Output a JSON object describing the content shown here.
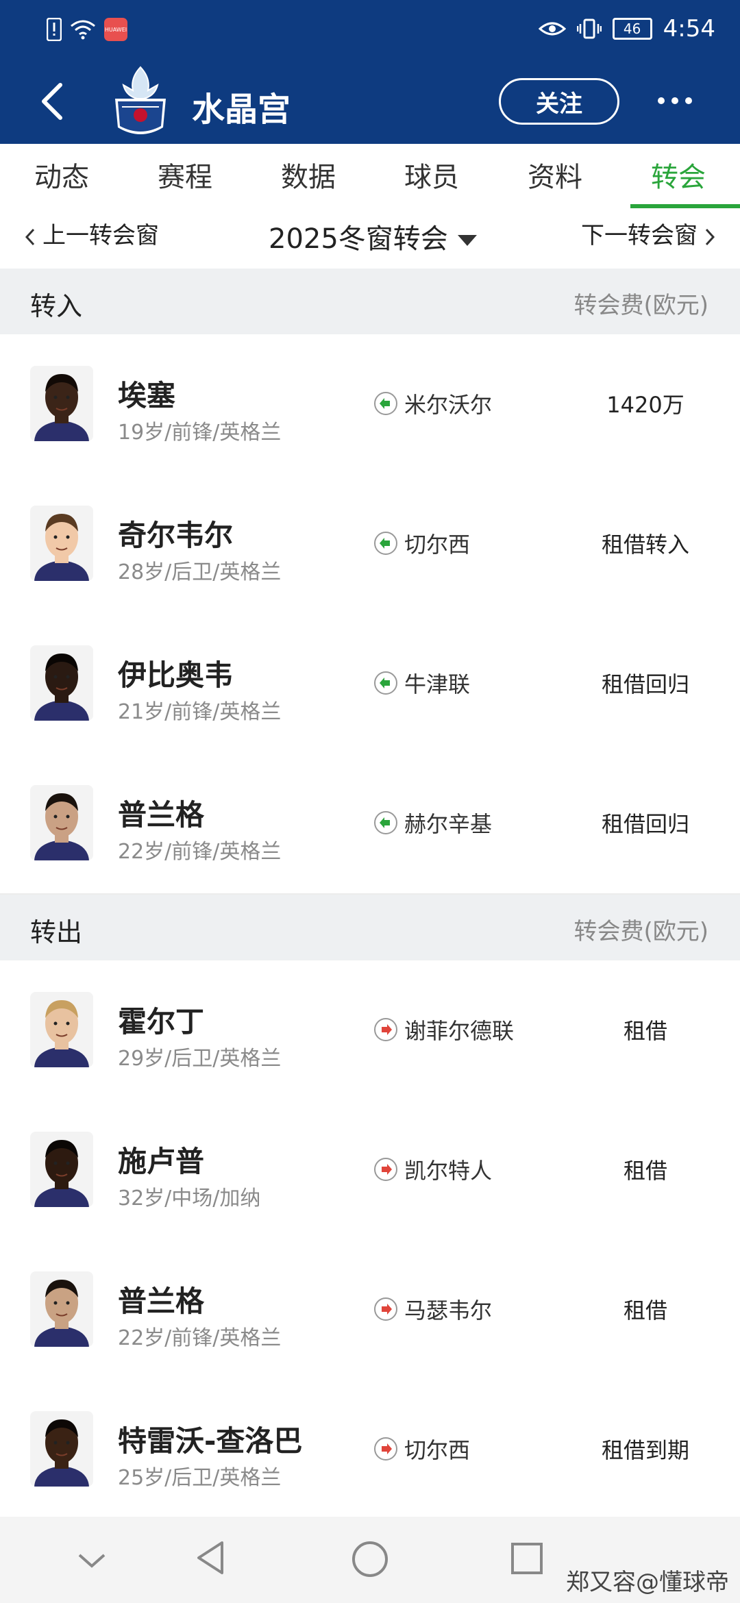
{
  "status_bar": {
    "time": "4:54",
    "battery": "46",
    "app_badge": "HUAWEI"
  },
  "nav": {
    "team": "水晶宫",
    "follow_label": "关注"
  },
  "tabs": [
    {
      "label": "动态",
      "active": false
    },
    {
      "label": "赛程",
      "active": false
    },
    {
      "label": "数据",
      "active": false
    },
    {
      "label": "球员",
      "active": false
    },
    {
      "label": "资料",
      "active": false
    },
    {
      "label": "转会",
      "active": true
    }
  ],
  "window": {
    "prev_label": "上一转会窗",
    "title": "2025冬窗转会",
    "next_label": "下一转会窗"
  },
  "sections": {
    "in": {
      "title": "转入",
      "fee_header": "转会费(欧元)"
    },
    "out": {
      "title": "转出",
      "fee_header": "转会费(欧元)"
    }
  },
  "transfers_in": [
    {
      "name": "埃塞",
      "info": "19岁/前锋/英格兰",
      "club": "米尔沃尔",
      "fee": "1420万"
    },
    {
      "name": "奇尔韦尔",
      "info": "28岁/后卫/英格兰",
      "club": "切尔西",
      "fee": "租借转入"
    },
    {
      "name": "伊比奥韦",
      "info": "21岁/前锋/英格兰",
      "club": "牛津联",
      "fee": "租借回归"
    },
    {
      "name": "普兰格",
      "info": "22岁/前锋/英格兰",
      "club": "赫尔辛基",
      "fee": "租借回归"
    }
  ],
  "transfers_out": [
    {
      "name": "霍尔丁",
      "info": "29岁/后卫/英格兰",
      "club": "谢菲尔德联",
      "fee": "租借"
    },
    {
      "name": "施卢普",
      "info": "32岁/中场/加纳",
      "club": "凯尔特人",
      "fee": "租借"
    },
    {
      "name": "普兰格",
      "info": "22岁/前锋/英格兰",
      "club": "马瑟韦尔",
      "fee": "租借"
    },
    {
      "name": "特雷沃-查洛巴",
      "info": "25岁/后卫/英格兰",
      "club": "切尔西",
      "fee": "租借到期"
    }
  ],
  "colors": {
    "header_bg": "#0e3b80",
    "accent_green": "#2aa53b",
    "arrow_in": "#2aa53b",
    "arrow_out": "#e0443a"
  },
  "watermark": "郑又容@懂球帝"
}
